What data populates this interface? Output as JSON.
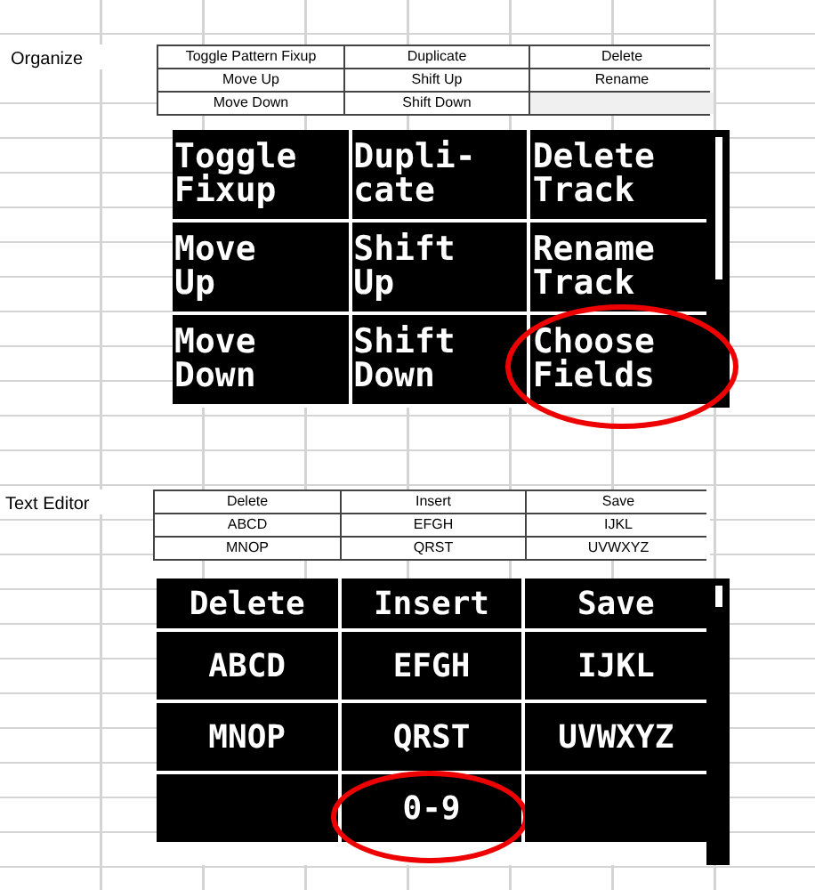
{
  "sections": [
    {
      "title": "Organize",
      "table": [
        [
          {
            "text": "Toggle Pattern Fixup"
          },
          {
            "text": "Duplicate"
          },
          {
            "text": "Delete"
          }
        ],
        [
          {
            "text": "Move Up"
          },
          {
            "text": "Shift Up"
          },
          {
            "text": "Rename"
          }
        ],
        [
          {
            "text": "Move Down"
          },
          {
            "text": "Shift Down"
          },
          {
            "kind": "blank"
          }
        ]
      ],
      "screen": {
        "kind": "menu",
        "rows": [
          [
            {
              "text": "Toggle\nFixup",
              "circled": false
            },
            {
              "text": "Dupli-\ncate",
              "circled": false
            },
            {
              "text": "Delete\nTrack",
              "circled": false
            }
          ],
          [
            {
              "text": "Move\nUp",
              "circled": false
            },
            {
              "text": "Shift\nUp",
              "circled": false
            },
            {
              "text": "Rename\nTrack",
              "circled": false
            }
          ],
          [
            {
              "text": "Move\nDown",
              "circled": false
            },
            {
              "text": "Shift\nDown",
              "circled": false
            },
            {
              "text": "Choose\nFields",
              "circled": true
            }
          ]
        ]
      }
    },
    {
      "title": "Text Editor",
      "table": [
        [
          {
            "text": "Delete"
          },
          {
            "text": "Insert"
          },
          {
            "text": "Save"
          }
        ],
        [
          {
            "text": "ABCD"
          },
          {
            "text": "EFGH"
          },
          {
            "text": "IJKL"
          }
        ],
        [
          {
            "text": "MNOP"
          },
          {
            "text": "QRST"
          },
          {
            "text": "UVWXYZ"
          }
        ]
      ],
      "screen": {
        "kind": "keypad",
        "rows": [
          [
            {
              "text": "Delete",
              "circled": false
            },
            {
              "text": "Insert",
              "circled": false
            },
            {
              "text": "Save",
              "circled": false
            }
          ],
          [
            {
              "text": "ABCD",
              "circled": false
            },
            {
              "text": "EFGH",
              "circled": false
            },
            {
              "text": "IJKL",
              "circled": false
            }
          ],
          [
            {
              "text": "MNOP",
              "circled": false
            },
            {
              "text": "QRST",
              "circled": false
            },
            {
              "text": "UVWXYZ",
              "circled": false
            }
          ],
          [
            {
              "circled": false
            },
            {
              "text": "0-9",
              "circled": true
            },
            {
              "circled": false
            }
          ]
        ]
      }
    }
  ]
}
